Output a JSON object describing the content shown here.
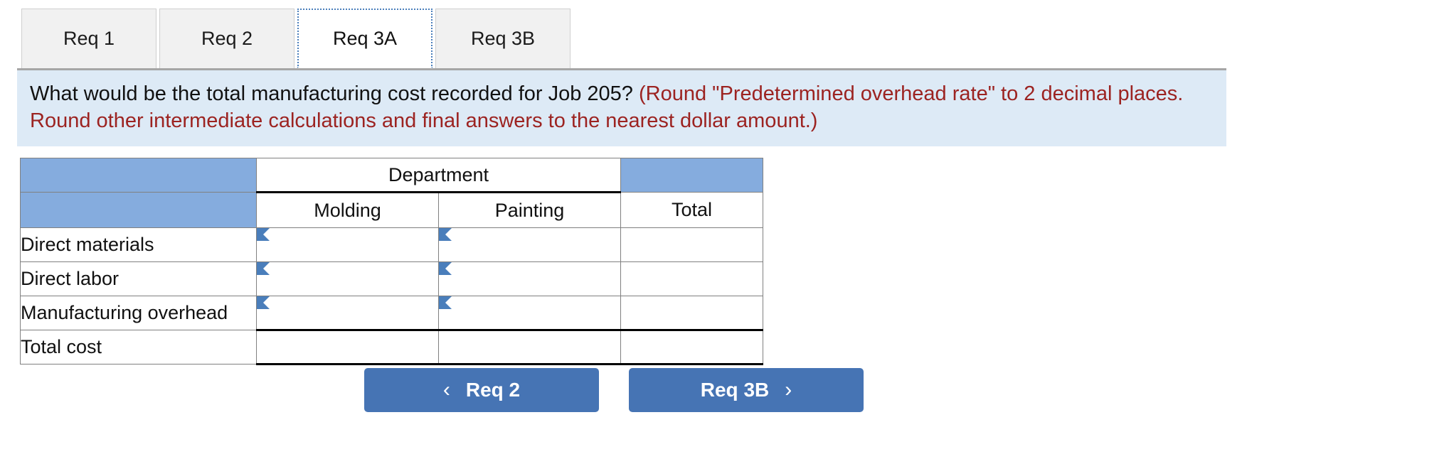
{
  "tabs": [
    {
      "label": "Req 1",
      "active": false
    },
    {
      "label": "Req 2",
      "active": false
    },
    {
      "label": "Req 3A",
      "active": true
    },
    {
      "label": "Req 3B",
      "active": false
    }
  ],
  "question": {
    "main": "What would be the total manufacturing cost recorded for Job 205?",
    "note": "(Round \"Predetermined overhead rate\" to 2 decimal places. Round other intermediate calculations and final answers to the nearest dollar amount.)"
  },
  "table": {
    "group_header": "Department",
    "corner_blank": "",
    "top_right_blank": "",
    "columns": [
      "Molding",
      "Painting",
      "Total"
    ],
    "rows": [
      {
        "label": "Direct materials",
        "molding": "",
        "painting": "",
        "total": "",
        "editable": true
      },
      {
        "label": "Direct labor",
        "molding": "",
        "painting": "",
        "total": "",
        "editable": true
      },
      {
        "label": "Manufacturing overhead",
        "molding": "",
        "painting": "",
        "total": "",
        "editable": true
      },
      {
        "label": "Total cost",
        "molding": "",
        "painting": "",
        "total": "",
        "editable": false
      }
    ]
  },
  "nav": {
    "prev": {
      "label": "Req 2",
      "chevron": "‹"
    },
    "next": {
      "label": "Req 3B",
      "chevron": "›"
    }
  },
  "colors": {
    "header_blue": "#85ACDE",
    "banner_blue": "#DDEAF6",
    "note_red": "#9C2321",
    "button_blue": "#4674B4",
    "input_border_blue": "#4A7EBB",
    "grid_gray": "#808080"
  }
}
